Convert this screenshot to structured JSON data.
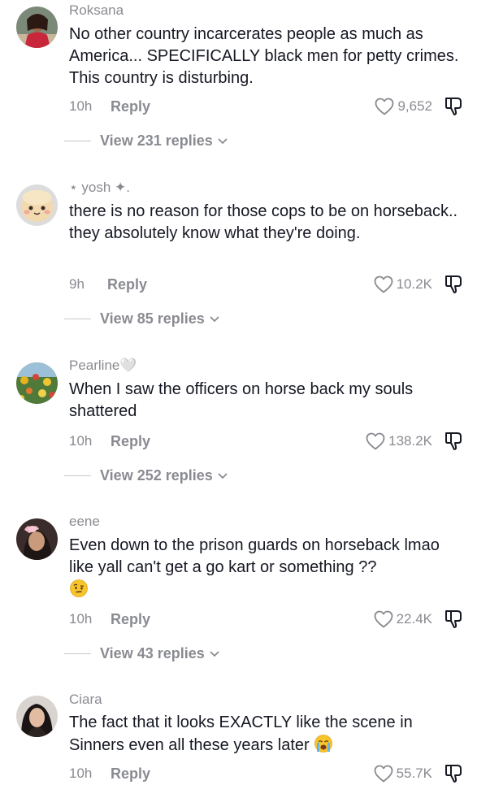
{
  "comments": [
    {
      "username": "Roksana",
      "text": "No other country incarcerates people as much as America... SPECIFICALLY black men for petty crimes. This country is disturbing.",
      "time": "10h",
      "reply_label": "Reply",
      "likes": "9,652",
      "view_replies": "View 231 replies",
      "avatar_icon": "avatar-woman-red-top"
    },
    {
      "username": "⋆ yosh ✦.",
      "text": "there is no reason for those cops to be on horseback.. they absolutely know what they're doing.",
      "time": "9h",
      "reply_label": "Reply",
      "likes": "10.2K",
      "view_replies": "View 85 replies",
      "avatar_icon": "avatar-plush-toy"
    },
    {
      "username": "Pearline🤍",
      "text": "When I saw the officers on horse back my souls shattered",
      "time": "10h",
      "reply_label": "Reply",
      "likes": "138.2K",
      "view_replies": "View 252 replies",
      "avatar_icon": "avatar-flowers"
    },
    {
      "username": "eene",
      "text": "Even down to the prison guards on horseback lmao like yall can't get a go kart or something ??",
      "emoji": "face-with-raised-eyebrow-emoji",
      "time": "10h",
      "reply_label": "Reply",
      "likes": "22.4K",
      "view_replies": "View 43 replies",
      "avatar_icon": "avatar-girl-pink-bow"
    },
    {
      "username": "Ciara",
      "text": "The fact that it looks EXACTLY like the scene in Sinners even all these years later",
      "emoji": "loudly-crying-face-emoji",
      "time": "10h",
      "reply_label": "Reply",
      "likes": "55.7K",
      "avatar_icon": "avatar-woman-dark-hair"
    }
  ],
  "colors": {
    "text": "#161823",
    "secondary": "#8a8b91",
    "divider": "#c7c8cc",
    "background": "#ffffff"
  },
  "icons": {
    "like": "heart-outline-icon",
    "dislike": "thumbs-down-outline-icon",
    "expand": "chevron-down-icon"
  }
}
